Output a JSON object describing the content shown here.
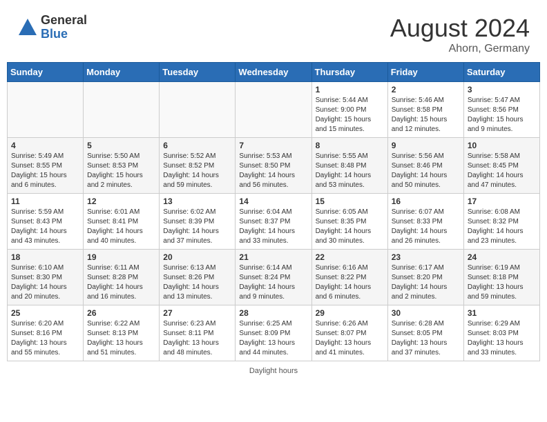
{
  "header": {
    "logo_general": "General",
    "logo_blue": "Blue",
    "month_year": "August 2024",
    "location": "Ahorn, Germany"
  },
  "days_of_week": [
    "Sunday",
    "Monday",
    "Tuesday",
    "Wednesday",
    "Thursday",
    "Friday",
    "Saturday"
  ],
  "footer": {
    "note": "Daylight hours"
  },
  "weeks": [
    {
      "days": [
        {
          "num": "",
          "info": ""
        },
        {
          "num": "",
          "info": ""
        },
        {
          "num": "",
          "info": ""
        },
        {
          "num": "",
          "info": ""
        },
        {
          "num": "1",
          "info": "Sunrise: 5:44 AM\nSunset: 9:00 PM\nDaylight: 15 hours\nand 15 minutes."
        },
        {
          "num": "2",
          "info": "Sunrise: 5:46 AM\nSunset: 8:58 PM\nDaylight: 15 hours\nand 12 minutes."
        },
        {
          "num": "3",
          "info": "Sunrise: 5:47 AM\nSunset: 8:56 PM\nDaylight: 15 hours\nand 9 minutes."
        }
      ]
    },
    {
      "days": [
        {
          "num": "4",
          "info": "Sunrise: 5:49 AM\nSunset: 8:55 PM\nDaylight: 15 hours\nand 6 minutes."
        },
        {
          "num": "5",
          "info": "Sunrise: 5:50 AM\nSunset: 8:53 PM\nDaylight: 15 hours\nand 2 minutes."
        },
        {
          "num": "6",
          "info": "Sunrise: 5:52 AM\nSunset: 8:52 PM\nDaylight: 14 hours\nand 59 minutes."
        },
        {
          "num": "7",
          "info": "Sunrise: 5:53 AM\nSunset: 8:50 PM\nDaylight: 14 hours\nand 56 minutes."
        },
        {
          "num": "8",
          "info": "Sunrise: 5:55 AM\nSunset: 8:48 PM\nDaylight: 14 hours\nand 53 minutes."
        },
        {
          "num": "9",
          "info": "Sunrise: 5:56 AM\nSunset: 8:46 PM\nDaylight: 14 hours\nand 50 minutes."
        },
        {
          "num": "10",
          "info": "Sunrise: 5:58 AM\nSunset: 8:45 PM\nDaylight: 14 hours\nand 47 minutes."
        }
      ]
    },
    {
      "days": [
        {
          "num": "11",
          "info": "Sunrise: 5:59 AM\nSunset: 8:43 PM\nDaylight: 14 hours\nand 43 minutes."
        },
        {
          "num": "12",
          "info": "Sunrise: 6:01 AM\nSunset: 8:41 PM\nDaylight: 14 hours\nand 40 minutes."
        },
        {
          "num": "13",
          "info": "Sunrise: 6:02 AM\nSunset: 8:39 PM\nDaylight: 14 hours\nand 37 minutes."
        },
        {
          "num": "14",
          "info": "Sunrise: 6:04 AM\nSunset: 8:37 PM\nDaylight: 14 hours\nand 33 minutes."
        },
        {
          "num": "15",
          "info": "Sunrise: 6:05 AM\nSunset: 8:35 PM\nDaylight: 14 hours\nand 30 minutes."
        },
        {
          "num": "16",
          "info": "Sunrise: 6:07 AM\nSunset: 8:33 PM\nDaylight: 14 hours\nand 26 minutes."
        },
        {
          "num": "17",
          "info": "Sunrise: 6:08 AM\nSunset: 8:32 PM\nDaylight: 14 hours\nand 23 minutes."
        }
      ]
    },
    {
      "days": [
        {
          "num": "18",
          "info": "Sunrise: 6:10 AM\nSunset: 8:30 PM\nDaylight: 14 hours\nand 20 minutes."
        },
        {
          "num": "19",
          "info": "Sunrise: 6:11 AM\nSunset: 8:28 PM\nDaylight: 14 hours\nand 16 minutes."
        },
        {
          "num": "20",
          "info": "Sunrise: 6:13 AM\nSunset: 8:26 PM\nDaylight: 14 hours\nand 13 minutes."
        },
        {
          "num": "21",
          "info": "Sunrise: 6:14 AM\nSunset: 8:24 PM\nDaylight: 14 hours\nand 9 minutes."
        },
        {
          "num": "22",
          "info": "Sunrise: 6:16 AM\nSunset: 8:22 PM\nDaylight: 14 hours\nand 6 minutes."
        },
        {
          "num": "23",
          "info": "Sunrise: 6:17 AM\nSunset: 8:20 PM\nDaylight: 14 hours\nand 2 minutes."
        },
        {
          "num": "24",
          "info": "Sunrise: 6:19 AM\nSunset: 8:18 PM\nDaylight: 13 hours\nand 59 minutes."
        }
      ]
    },
    {
      "days": [
        {
          "num": "25",
          "info": "Sunrise: 6:20 AM\nSunset: 8:16 PM\nDaylight: 13 hours\nand 55 minutes."
        },
        {
          "num": "26",
          "info": "Sunrise: 6:22 AM\nSunset: 8:13 PM\nDaylight: 13 hours\nand 51 minutes."
        },
        {
          "num": "27",
          "info": "Sunrise: 6:23 AM\nSunset: 8:11 PM\nDaylight: 13 hours\nand 48 minutes."
        },
        {
          "num": "28",
          "info": "Sunrise: 6:25 AM\nSunset: 8:09 PM\nDaylight: 13 hours\nand 44 minutes."
        },
        {
          "num": "29",
          "info": "Sunrise: 6:26 AM\nSunset: 8:07 PM\nDaylight: 13 hours\nand 41 minutes."
        },
        {
          "num": "30",
          "info": "Sunrise: 6:28 AM\nSunset: 8:05 PM\nDaylight: 13 hours\nand 37 minutes."
        },
        {
          "num": "31",
          "info": "Sunrise: 6:29 AM\nSunset: 8:03 PM\nDaylight: 13 hours\nand 33 minutes."
        }
      ]
    }
  ]
}
